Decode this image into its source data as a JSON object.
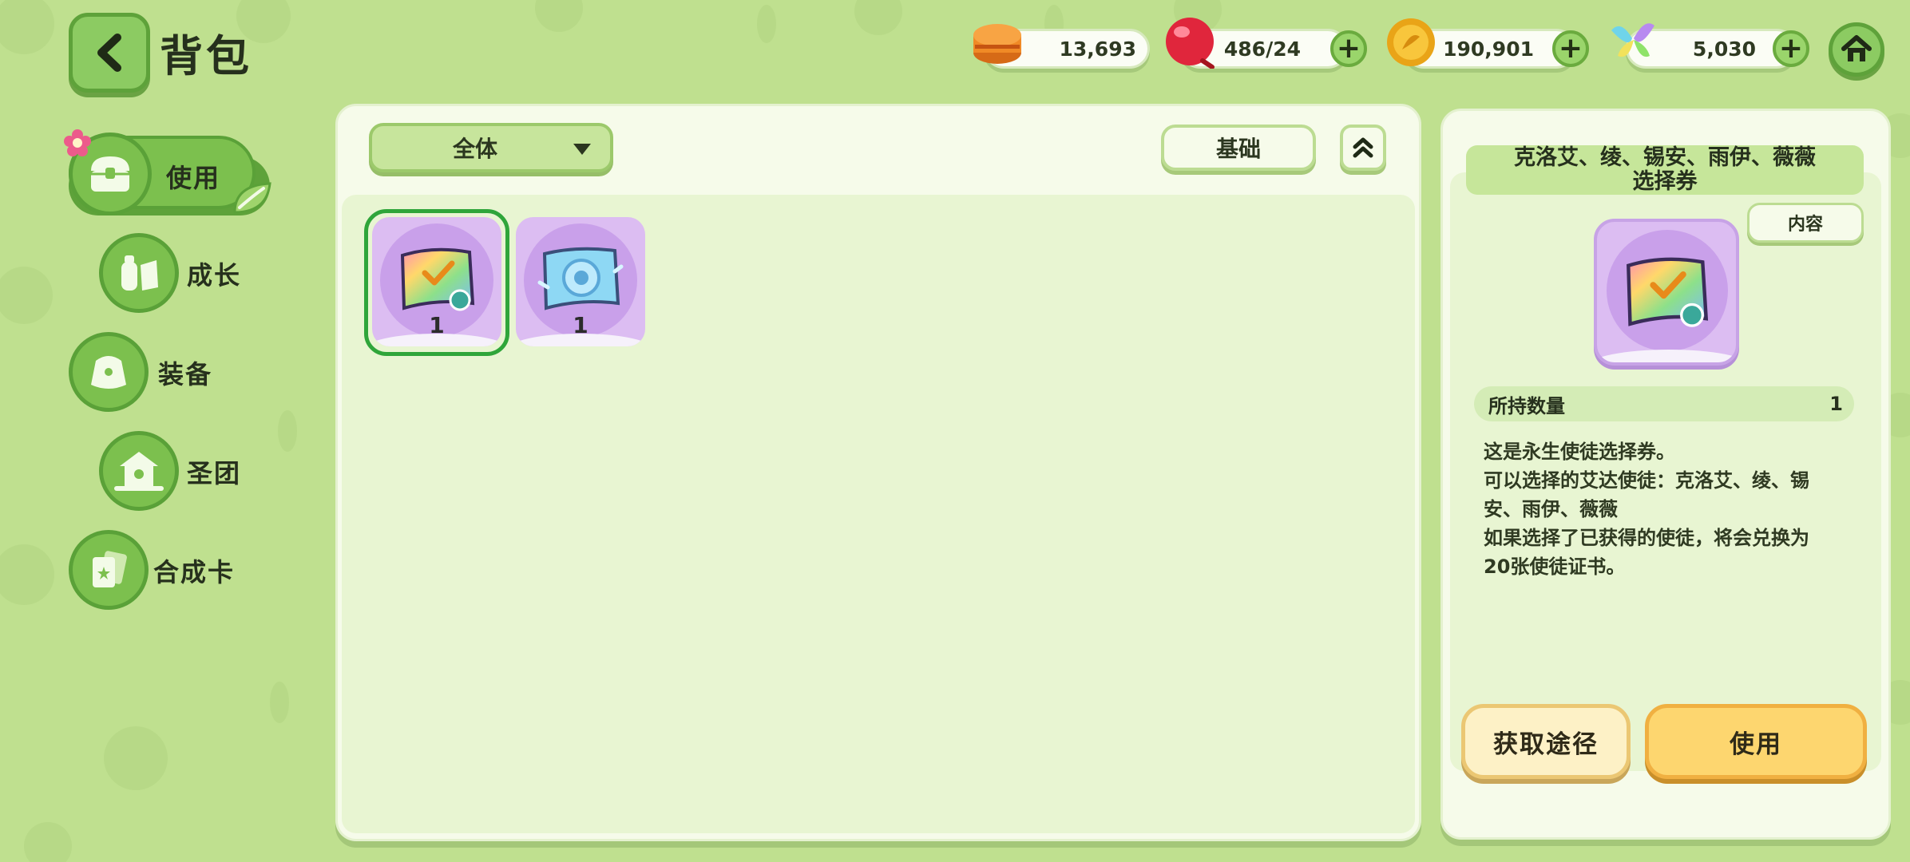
{
  "header": {
    "title": "背包",
    "resources": [
      {
        "icon": "food-icon",
        "value": "13,693"
      },
      {
        "icon": "candy-icon",
        "value": "486/24"
      },
      {
        "icon": "coin-icon",
        "value": "190,901"
      },
      {
        "icon": "crystal-icon",
        "value": "5,030"
      }
    ],
    "plus_label": "+"
  },
  "sidebar": {
    "items": [
      {
        "label": "使用",
        "icon": "chest-icon",
        "active": true
      },
      {
        "label": "成长",
        "icon": "potion-icon"
      },
      {
        "label": "装备",
        "icon": "outfit-icon"
      },
      {
        "label": "圣团",
        "icon": "shrine-icon"
      },
      {
        "label": "合成卡",
        "icon": "card-icon"
      }
    ]
  },
  "main": {
    "filter_selected": "全体",
    "sort_label": "基础",
    "items": [
      {
        "name": "rainbow-ticket",
        "count": "1",
        "selected": true
      },
      {
        "name": "blue-ticket",
        "count": "1",
        "selected": false
      }
    ]
  },
  "detail": {
    "title_line1": "克洛艾、绫、锡安、雨伊、薇薇",
    "title_line2": "选择券",
    "content_button": "内容",
    "quantity_label": "所持数量",
    "quantity_value": "1",
    "description_lines": [
      "这是永生使徒选择券。",
      "可以选择的艾达使徒：克洛艾、绫、锡",
      "安、雨伊、薇薇",
      "如果选择了已获得的使徒，将会兑换为",
      "20张使徒证书。"
    ],
    "source_button": "获取途径",
    "use_button": "使用"
  },
  "colors": {
    "background": "#bfe08f",
    "panel": "#f6fbea",
    "accent_green": "#7cc04e",
    "item_purple": "#dcbdf2",
    "use_button": "#fdd66f"
  }
}
